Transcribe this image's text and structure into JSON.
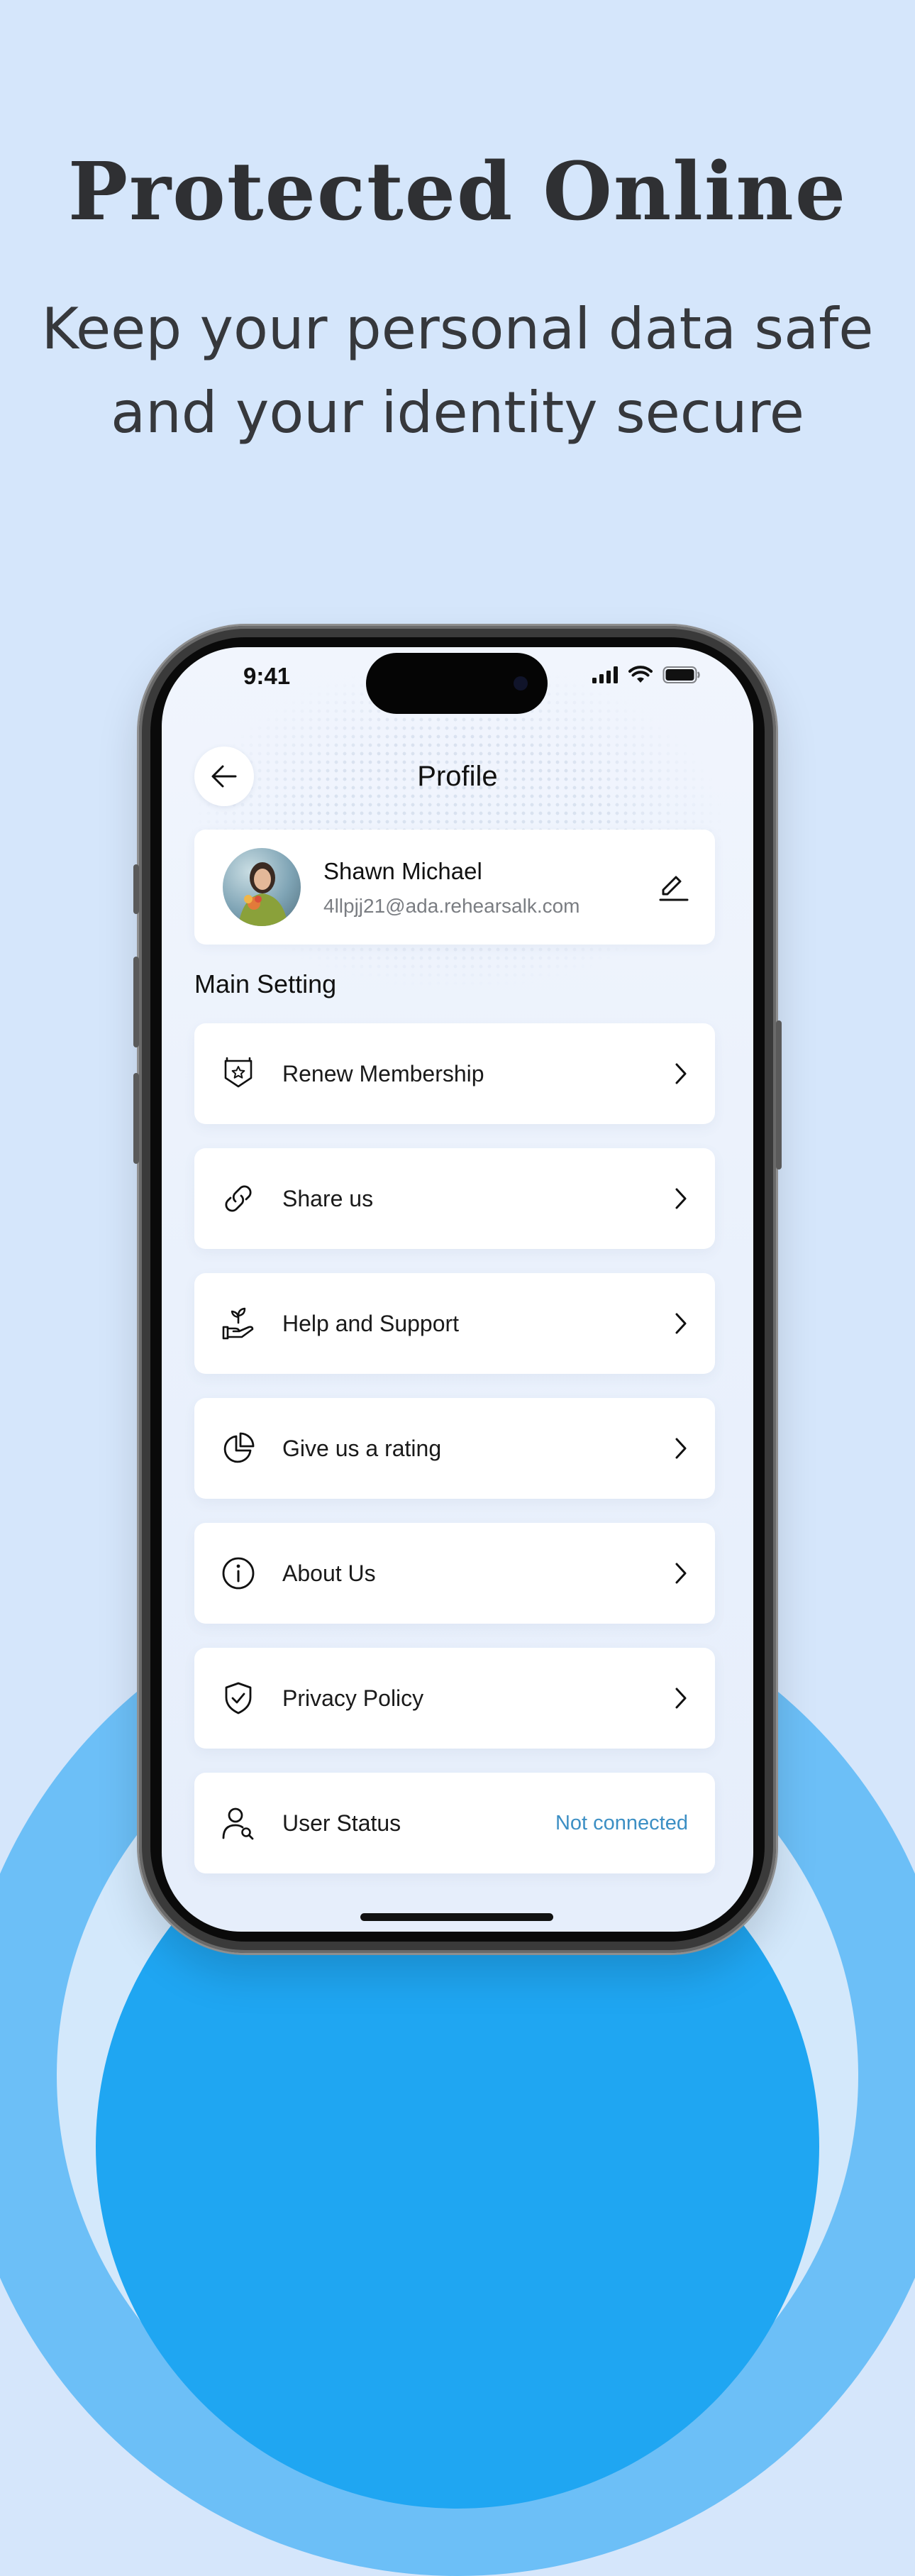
{
  "headline": "Protected Online",
  "subline": [
    "Keep your personal data safe",
    "and your identity secure"
  ],
  "status_bar": {
    "time": "9:41"
  },
  "screen": {
    "title": "Profile"
  },
  "profile": {
    "name": "Shawn Michael",
    "email": "4llpjj21@ada.rehearsalk.com"
  },
  "section_title": "Main Setting",
  "menu": [
    {
      "label": "Renew Membership",
      "icon": "badge-star-icon"
    },
    {
      "label": "Share us",
      "icon": "link-icon"
    },
    {
      "label": "Help and Support",
      "icon": "hand-plant-icon"
    },
    {
      "label": "Give us a rating",
      "icon": "pie-chart-icon"
    },
    {
      "label": "About Us",
      "icon": "info-icon"
    },
    {
      "label": "Privacy Policy",
      "icon": "shield-check-icon"
    },
    {
      "label": "User Status",
      "icon": "user-search-icon",
      "status": "Not connected"
    }
  ],
  "colors": {
    "background": "#d5e6fb",
    "arc_light": "#6cbff7",
    "arc_dark": "#1fa6f2",
    "status_link": "#3c8fc4"
  }
}
